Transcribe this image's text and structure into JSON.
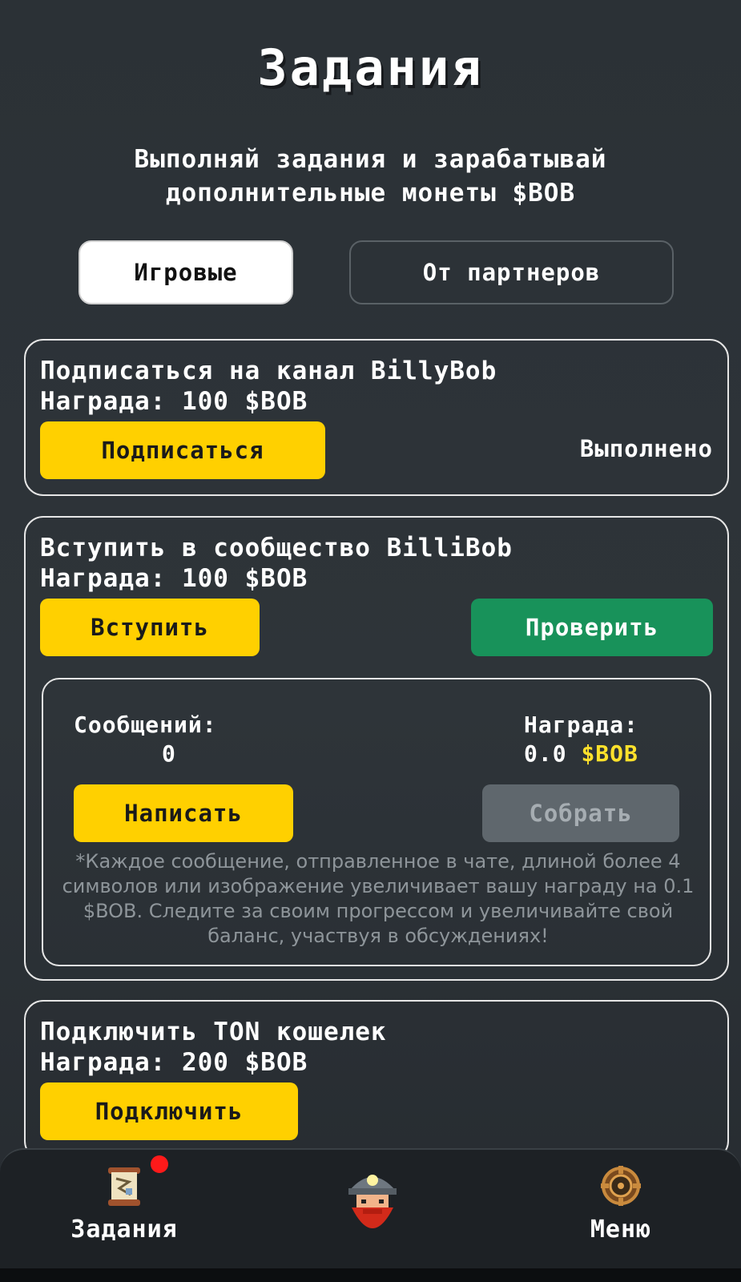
{
  "header": {
    "title": "Задания",
    "subtitle_line1": "Выполняй задания и зарабатывай",
    "subtitle_line2": "дополнительные монеты $BOB"
  },
  "tabs": [
    {
      "label": "Игровые",
      "active": true
    },
    {
      "label": "От партнеров",
      "active": false
    }
  ],
  "tasks": [
    {
      "title": "Подписаться на канал BillyBob",
      "reward": "Награда: 100 $BOB",
      "action_label": "Подписаться",
      "status": "Выполнено"
    },
    {
      "title": "Вступить в сообщество BilliBob",
      "reward": "Награда: 100 $BOB",
      "action_label": "Вступить",
      "check_label": "Проверить",
      "messages": {
        "messages_label": "Сообщений:",
        "messages_value": "0",
        "reward_label": "Награда:",
        "reward_value": "0.0",
        "reward_currency": "$BOB",
        "write_label": "Написать",
        "collect_label": "Собрать",
        "note": "*Каждое сообщение, отправленное в чате, длиной более 4 символов или изображение увеличивает вашу награду на 0.1 $BOB. Следите за своим прогрессом и увеличивайте свой баланс, участвуя в обсуждениях!"
      }
    },
    {
      "title": "Подключить TON кошелек",
      "reward": "Награда: 200 $BOB",
      "action_label": "Подключить"
    }
  ],
  "bottom_nav": {
    "tasks_label": "Задания",
    "tasks_icon": "scroll-map-icon",
    "center_icon": "miner-avatar-icon",
    "menu_label": "Меню",
    "menu_icon": "gear-emblem-icon",
    "has_notification": true
  },
  "colors": {
    "background": "#2b3136",
    "accent_yellow": "#ffd000",
    "accent_green": "#18925a",
    "disabled_gray": "#5f676d",
    "notification_red": "#ff1a1a"
  }
}
